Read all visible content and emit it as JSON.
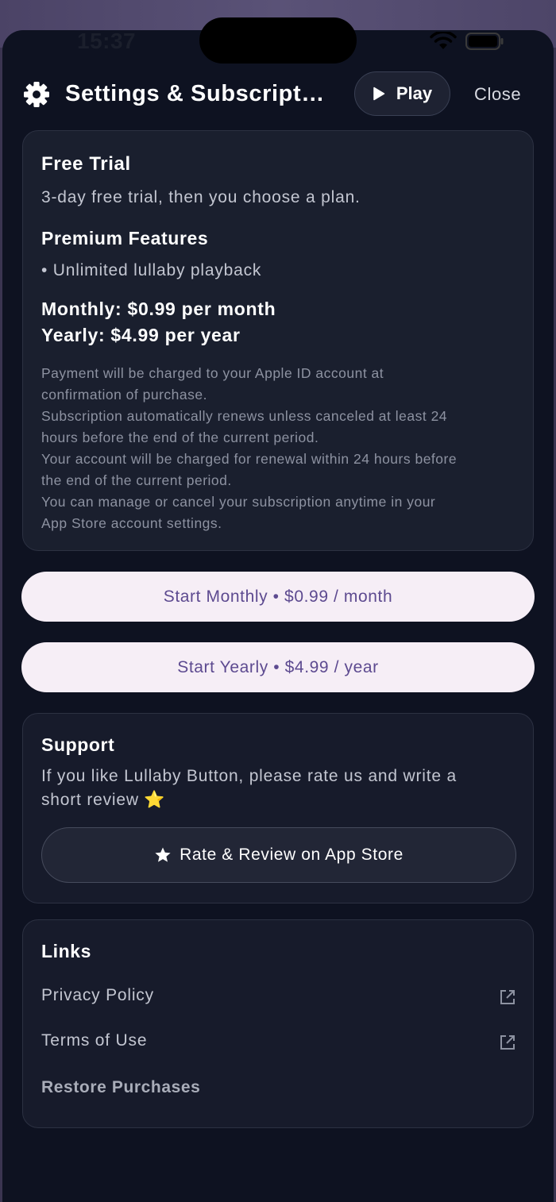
{
  "status_bar": {
    "time": "15:37"
  },
  "header": {
    "title": "Settings & Subscript…",
    "play_label": "Play",
    "close_label": "Close",
    "icon": "gear-icon"
  },
  "plans_card": {
    "trial_heading": "Free Trial",
    "trial_text": "3-day free trial, then you choose a plan.",
    "features_heading": "Premium Features",
    "feature_item": "• Unlimited lullaby playback",
    "monthly_price": "Monthly: $0.99 per month",
    "yearly_price": "Yearly: $4.99 per year",
    "legal_lines": [
      "Payment will be charged to your Apple ID account at",
      "confirmation of purchase.",
      "Subscription automatically renews unless canceled at least 24",
      "hours before the end of the current period.",
      "Your account will be charged for renewal within 24 hours before",
      "the end of the current period.",
      "You can manage or cancel your subscription anytime in your",
      "App Store account settings."
    ]
  },
  "cta": {
    "monthly_label": "Start Monthly • $0.99 / month",
    "yearly_label": "Start Yearly • $4.99 / year"
  },
  "support": {
    "heading": "Support",
    "text_line1": "If you like Lullaby Button, please rate us and write a",
    "text_line2": "short review ⭐",
    "rate_label": "Rate & Review on App Store"
  },
  "links": {
    "heading": "Links",
    "privacy_label": "Privacy Policy",
    "terms_label": "Terms of Use",
    "restore_label": "Restore Purchases"
  },
  "colors": {
    "sheet_background": "#0e1221",
    "cta_background": "#f6eef6",
    "cta_text": "#5d4a90"
  }
}
